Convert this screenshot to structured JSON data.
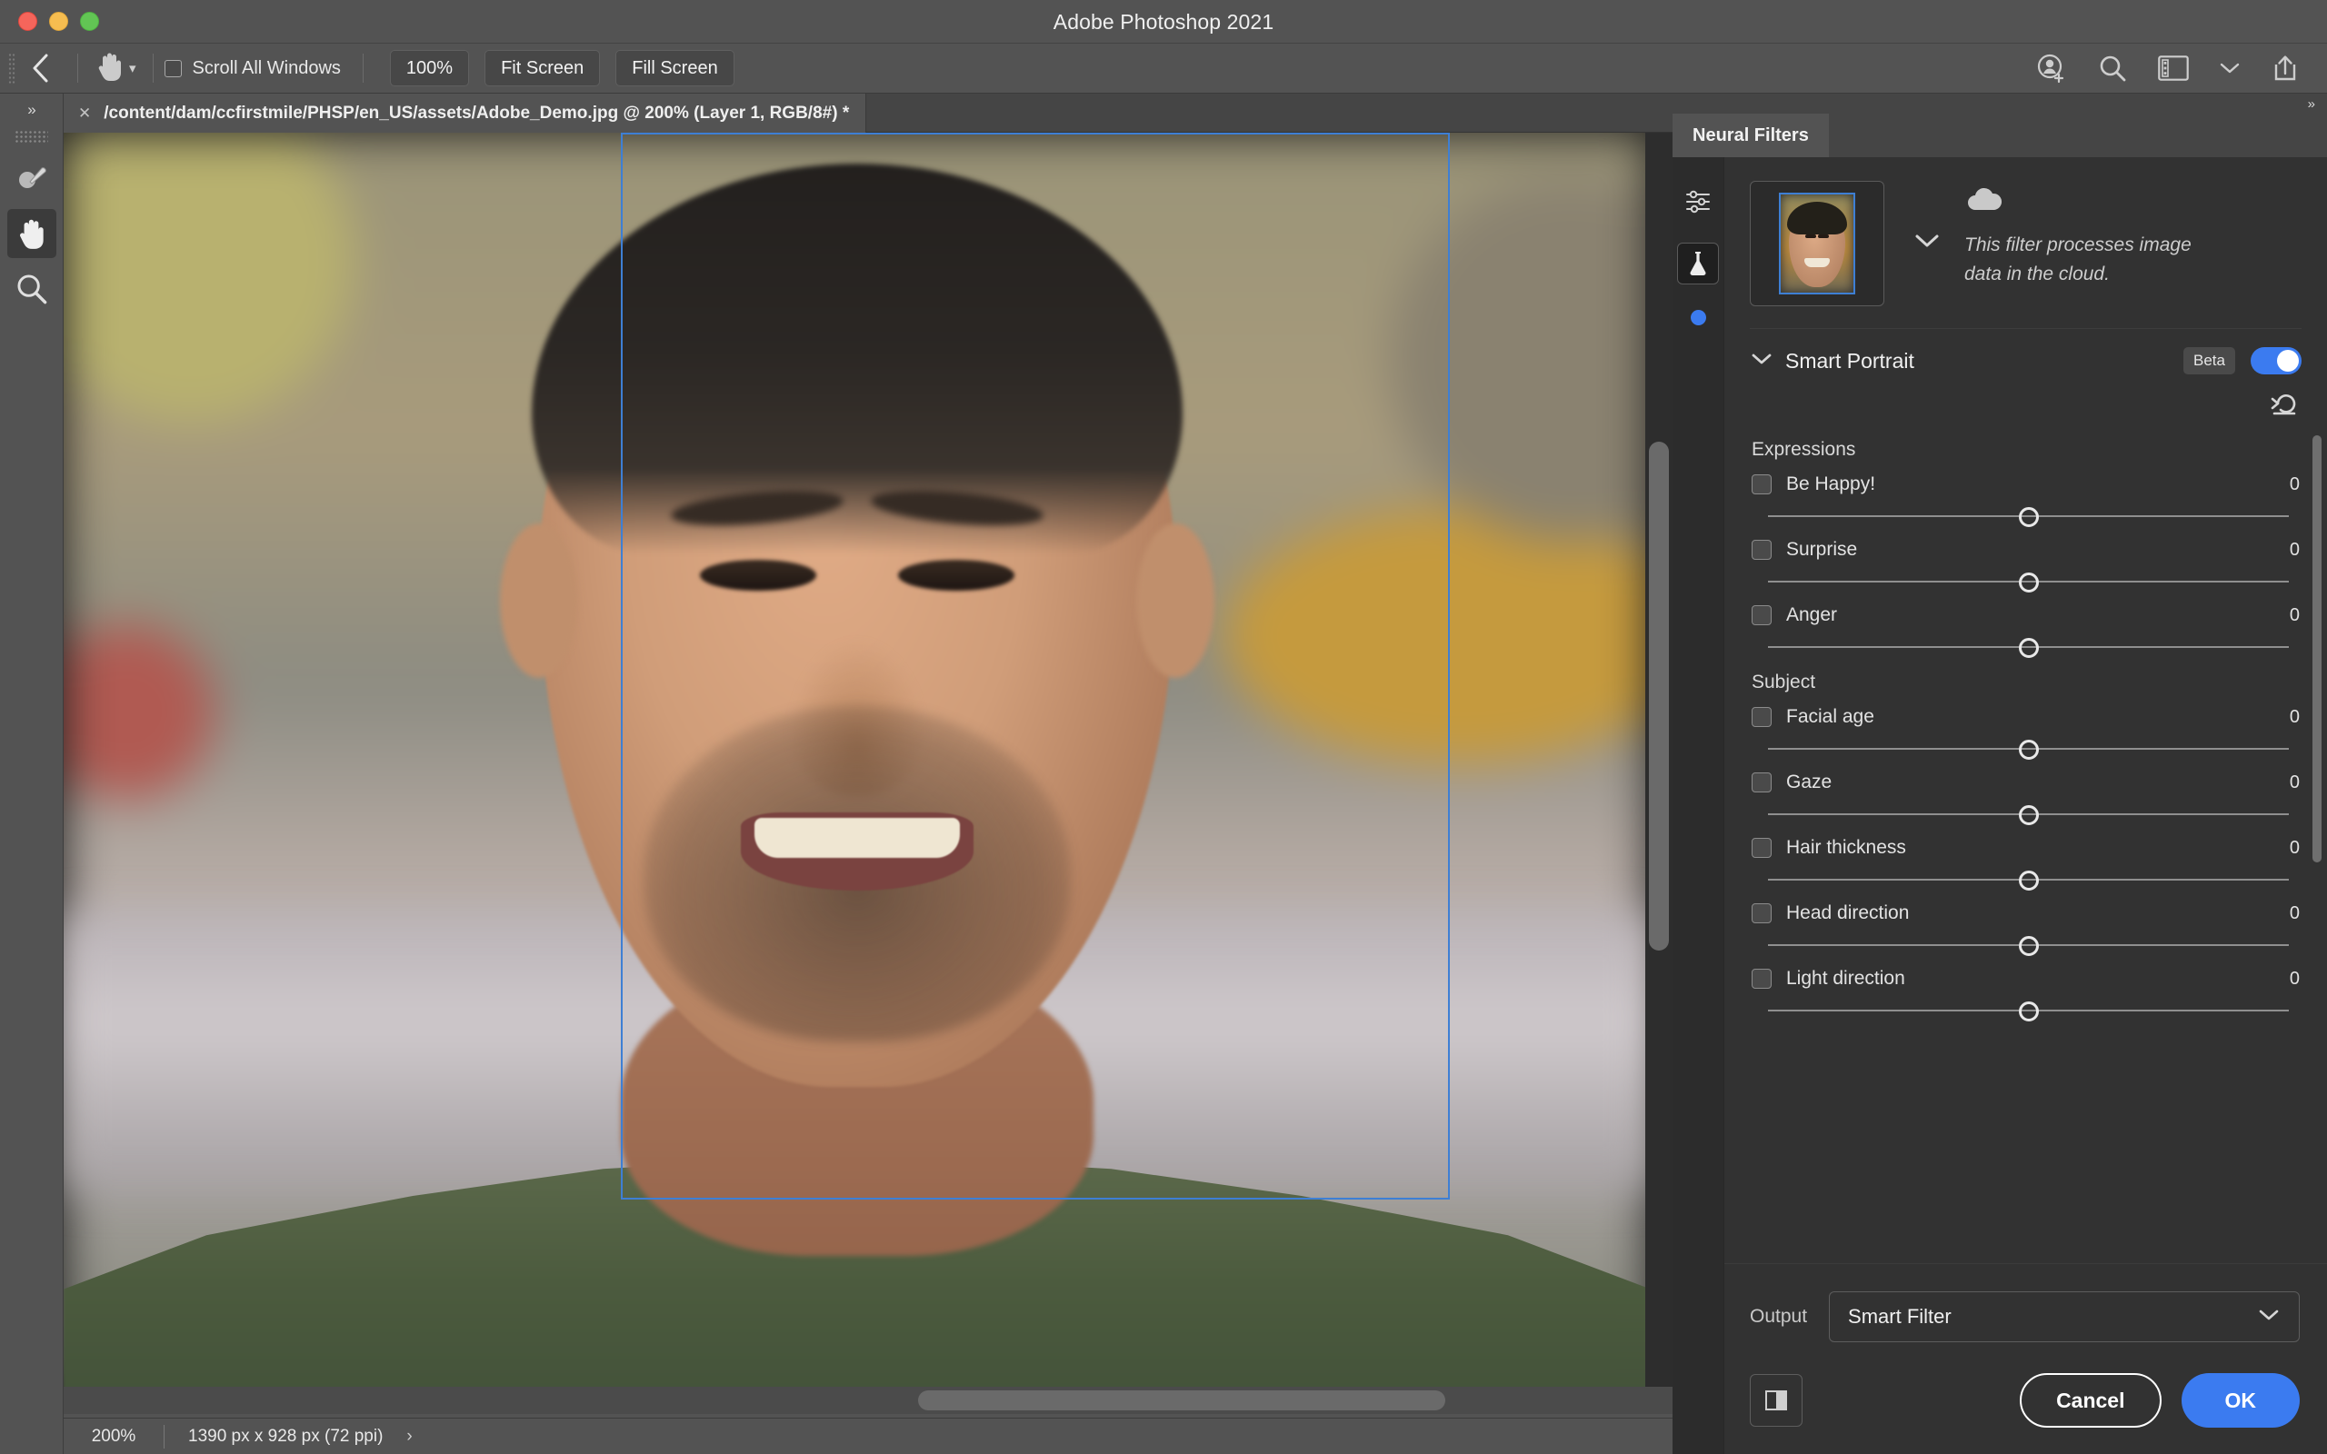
{
  "window": {
    "title": "Adobe Photoshop 2021",
    "traffic_lights": [
      "close",
      "minimize",
      "zoom"
    ]
  },
  "options_bar": {
    "back_icon": "back-chevron-icon",
    "tool_icon": "hand-tool-icon",
    "tool_chevron": "chevron-down-icon",
    "scroll_all_windows_label": "Scroll All Windows",
    "scroll_all_windows_checked": false,
    "buttons": [
      "100%",
      "Fit Screen",
      "Fill Screen"
    ],
    "zoom_100_label": "100%",
    "fit_screen_label": "Fit Screen",
    "fill_screen_label": "Fill Screen",
    "right_icons": [
      "add-user-icon",
      "search-icon",
      "workspace-icon",
      "chevron-down-icon",
      "share-export-icon"
    ]
  },
  "left_toolbar": {
    "expand_label": "»",
    "tools": [
      {
        "name": "spot-healing-brush-tool",
        "active": false
      },
      {
        "name": "hand-tool",
        "active": true
      },
      {
        "name": "zoom-tool",
        "active": false
      }
    ]
  },
  "document": {
    "tab_label": "/content/dam/ccfirstmile/PHSP/en_US/assets/Adobe_Demo.jpg @ 200% (Layer 1, RGB/8#) *",
    "close_icon": "close-icon"
  },
  "status_bar": {
    "zoom": "200%",
    "dimensions": "1390 px x 928 px (72 ppi)",
    "expand_icon": "chevron-right-icon"
  },
  "panel": {
    "collapse_icon": "double-chevron-right-icon",
    "tab_label": "Neural Filters",
    "rail": [
      {
        "name": "all-filters-icon",
        "active": false
      },
      {
        "name": "beta-filters-flask-icon",
        "active": true
      }
    ],
    "rail_dot_color": "#3b7bf0",
    "thumbnail_chevron": "chevron-down-icon",
    "cloud_icon": "cloud-icon",
    "cloud_note": "This filter processes image data in the cloud.",
    "filter": {
      "collapse_icon": "chevron-down-icon",
      "title": "Smart Portrait",
      "badge": "Beta",
      "enabled": true,
      "reset_icon": "reset-undo-icon"
    },
    "sections": [
      {
        "title": "Expressions",
        "sliders": [
          {
            "label": "Be Happy!",
            "value": "0",
            "checked": false,
            "knob_percent": 50
          },
          {
            "label": "Surprise",
            "value": "0",
            "checked": false,
            "knob_percent": 50
          },
          {
            "label": "Anger",
            "value": "0",
            "checked": false,
            "knob_percent": 50
          }
        ]
      },
      {
        "title": "Subject",
        "sliders": [
          {
            "label": "Facial age",
            "value": "0",
            "checked": false,
            "knob_percent": 50
          },
          {
            "label": "Gaze",
            "value": "0",
            "checked": false,
            "knob_percent": 50
          },
          {
            "label": "Hair thickness",
            "value": "0",
            "checked": false,
            "knob_percent": 50
          },
          {
            "label": "Head direction",
            "value": "0",
            "checked": false,
            "knob_percent": 50
          },
          {
            "label": "Light direction",
            "value": "0",
            "checked": false,
            "knob_percent": 50
          }
        ]
      }
    ],
    "output": {
      "label": "Output",
      "value": "Smart Filter",
      "chevron": "chevron-down-icon",
      "options": [
        "Smart Filter"
      ]
    },
    "footer": {
      "preview_icon": "split-preview-icon",
      "cancel_label": "Cancel",
      "ok_label": "OK",
      "ok_color": "#3b7bf0"
    }
  }
}
